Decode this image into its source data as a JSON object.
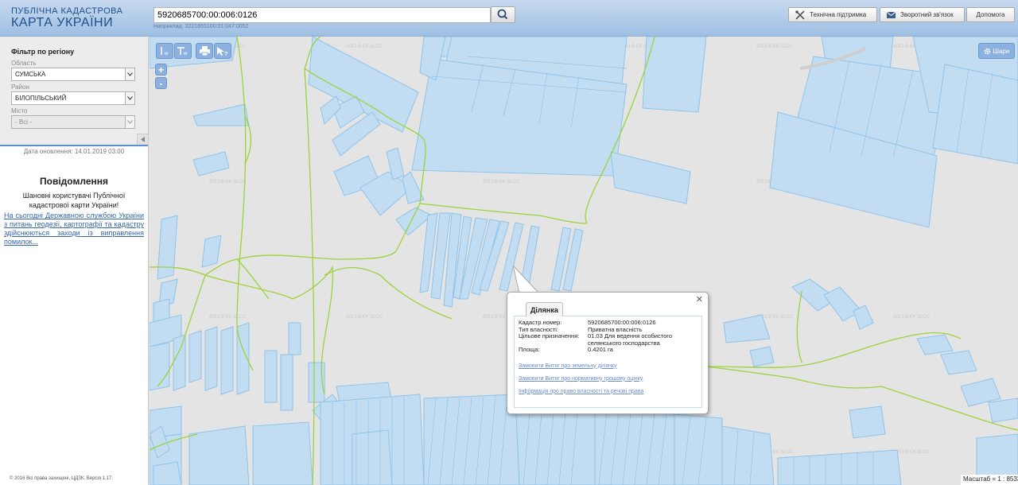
{
  "header": {
    "logo_line1": "ПУБЛІЧНА КАДАСТРОВА",
    "logo_line2": "КАРТА УКРАЇНИ",
    "search_value": "5920685700:00:006:0126",
    "search_hint": "Наприклад: 3221655100:01:047:0052",
    "buttons": [
      "Технічна підтримка",
      "Зворотний зв'язок",
      "Допомога"
    ]
  },
  "sidebar": {
    "filter_title": "Фільтр по регіону",
    "oblast_label": "Область",
    "oblast_value": "СУМСЬКА",
    "rayon_label": "Район",
    "rayon_value": "БІЛОПІЛЬСЬКИЙ",
    "misto_label": "Місто",
    "misto_value": "- Всі -",
    "update_text": "Дата оновлення: 14.01.2019 03:00",
    "notice_title": "Повідомлення",
    "notice_text": "Шановні користувачі Публічної кадастрової карти України!",
    "notice_link": "На сьогодні Державною службою України з питань геодезії, картографії та кадастру здійснюються заходи із виправлення помилок...",
    "copyright": "© 2016 Всі права захищені, ЦДЗК. Версія 1.17."
  },
  "map": {
    "layers_label": "Шари",
    "scale_text": "Масштаб = 1 : 8533",
    "watermark": "2013 В ЄК SLCC",
    "zoom_in": "+",
    "zoom_out": "-"
  },
  "popup": {
    "tab": "Ділянка",
    "rows": [
      {
        "k": "Кадастр.номер:",
        "v": "5920685700:00:006:0126"
      },
      {
        "k": "Тип власності:",
        "v": "Приватна власність"
      },
      {
        "k": "Цільове призначення:",
        "v": "01.03 Для ведення особистого селянського господарства"
      },
      {
        "k": "Площа:",
        "v": "0.4201 га"
      }
    ],
    "links": [
      "Замовити Витяг про земельну ділянку",
      "Замовити Витяг про нормативну грошову оцінку",
      "Інформація про право власності та речові права"
    ]
  },
  "colors": {
    "parcel_fill": "#c2ddf2",
    "parcel_stroke": "#8fc3ea",
    "boundary": "#9cd23a",
    "header": "#b3cde9",
    "accent": "#5f8fcc"
  }
}
